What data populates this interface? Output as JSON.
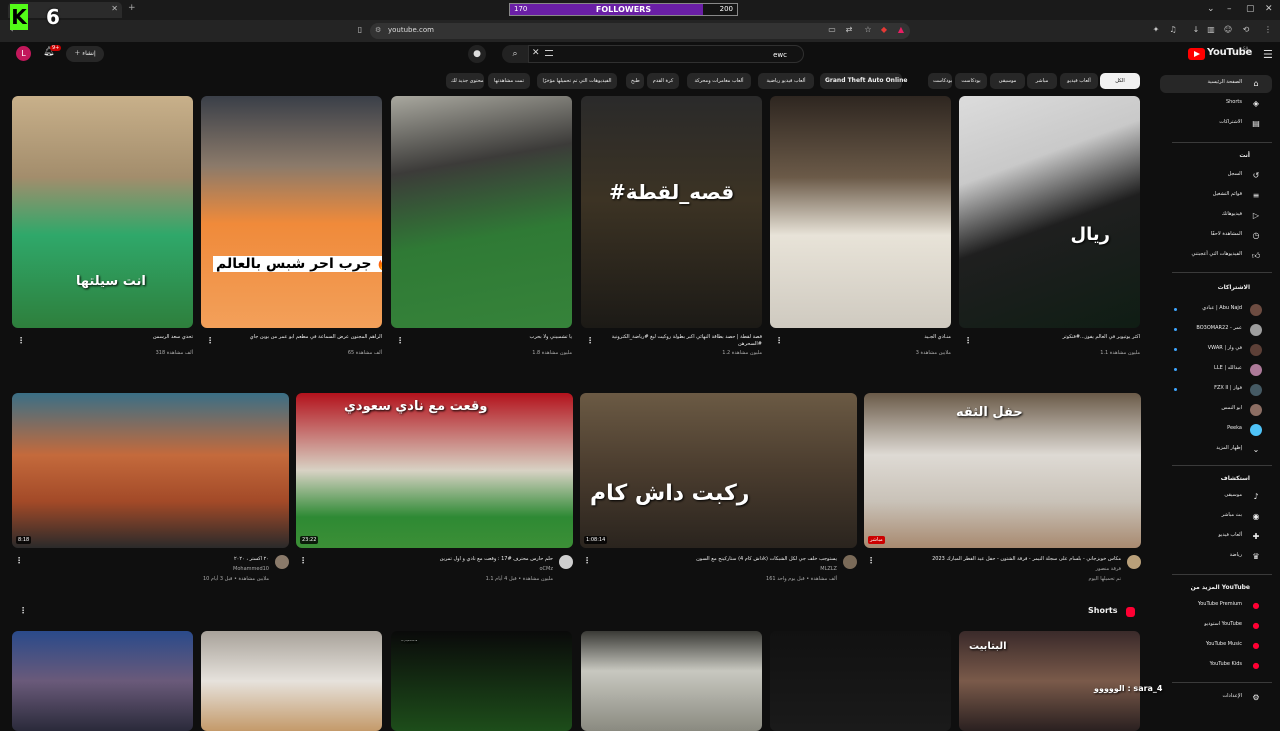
{
  "browser": {
    "tab_title": "",
    "url": "youtube.com"
  },
  "overlay": {
    "kick_logo": "K",
    "kick_number": "6",
    "followers_label": "FOLLOWERS",
    "followers_current": "170",
    "followers_goal": "200",
    "followers_fraction": 0.85,
    "chat_line": "الووووو : sara_4"
  },
  "header": {
    "logo_text": "YouTube",
    "logo_region": "SA",
    "search_value": "ewc",
    "create_label": "إنشاء",
    "notification_count": "9+",
    "avatar_letter": "L"
  },
  "chips": [
    {
      "label": "الكل"
    },
    {
      "label": "ألعاب فيديو"
    },
    {
      "label": "مباشر"
    },
    {
      "label": "موسيقى"
    },
    {
      "label": "بودكاست"
    },
    {
      "label": "بودكاست"
    },
    {
      "label": "Grand Theft Auto Online"
    },
    {
      "label": "ألعاب فيديو رياضية"
    },
    {
      "label": "ألعاب مغامرات ومحركة"
    },
    {
      "label": "كرة القدم"
    },
    {
      "label": "طبخ"
    },
    {
      "label": "الفيديوهات التي تم تحميلها مؤخرًا"
    },
    {
      "label": "تمت مشاهدتها"
    },
    {
      "label": "محتوى جديد لك"
    }
  ],
  "sidebar": {
    "main": [
      {
        "label": "الصفحة الرئيسية",
        "icon": "home-icon"
      },
      {
        "label": "Shorts",
        "icon": "shorts-icon"
      },
      {
        "label": "الاشتراكات",
        "icon": "subscriptions-icon"
      }
    ],
    "you_heading": "أنت",
    "you": [
      {
        "label": "السجل",
        "icon": "history-icon"
      },
      {
        "label": "قوائم التشغيل",
        "icon": "playlist-icon"
      },
      {
        "label": "فيديوهاتك",
        "icon": "your-videos-icon"
      },
      {
        "label": "المشاهدة لاحقًا",
        "icon": "watch-later-icon"
      },
      {
        "label": "الفيديوهات التي أعجبتني",
        "icon": "like-icon"
      }
    ],
    "subs_heading": "الاشتراكات",
    "subs": [
      {
        "label": "عبادي | Abu Najd"
      },
      {
        "label": "BO3OMAR22 - عمر"
      },
      {
        "label": "VWAR | في وار"
      },
      {
        "label": "LLE | عبدالله"
      },
      {
        "label": "FZX II | فواز"
      },
      {
        "label": "ابو النمس"
      },
      {
        "label": "Peeka"
      }
    ],
    "show_more": "إظهار المزيد",
    "explore_heading": "استكشاف",
    "explore": [
      {
        "label": "موسيقى",
        "icon": "music-icon"
      },
      {
        "label": "بث مباشر",
        "icon": "live-icon"
      },
      {
        "label": "ألعاب فيديو",
        "icon": "gaming-icon"
      },
      {
        "label": "رياضة",
        "icon": "trophy-icon"
      }
    ],
    "more_heading": "المزيد من YouTube",
    "more": [
      {
        "label": "YouTube Premium"
      },
      {
        "label": "استوديو YouTube"
      },
      {
        "label": "YouTube Music"
      },
      {
        "label": "YouTube Kids"
      }
    ],
    "settings": "الإعدادات"
  },
  "row1": [
    {
      "thumb_text": "ريال",
      "title": "أكثر يوتيوبر في العالم يفوز...#فتكوتر",
      "meta": "1.1 مليون مشاهدة"
    },
    {
      "thumb_text": "",
      "title": "منـادي الجـيد",
      "meta": "3 ملايين مشاهدة"
    },
    {
      "thumb_text": "#قصه_لقطة",
      "title": "قصة لقطة | حصد بطاقة النهائي اكبر بطولة روكيت ليغ #رياضة_الكترونية #السحرهن",
      "meta": "1.2 مليون مشاهدة"
    },
    {
      "thumb_text": "",
      "title": "يا تشمبيني ولا بحرب",
      "meta": "1.8 مليون مشاهدة"
    },
    {
      "thumb_text": "جرب احر شبس بالعالم 🔥",
      "title": "الراهم المجنون عرض السماعة في مطعم ابو عمر من بوين جاي",
      "meta": "65 ألف مشاهدة"
    },
    {
      "thumb_text": "انت سيلتها",
      "title": "تحدي سعد الرسمن",
      "meta": "318 ألف مشاهدة"
    }
  ],
  "row2": [
    {
      "thumb_text": "حفل الثقه",
      "duration": "مباشر",
      "title": "مكاس خويزجاني - بلسام على سجلة النيمر - فرقة الشتون - حفل عيد الفطر المبارك 2023",
      "channel": "فرقة منصور",
      "meta": "تم تحميلها اليوم"
    },
    {
      "thumb_text": "ركبت داش كام",
      "duration": "1:08:14",
      "title": "ستاركينج مع السون (داش كام 4k) يستوجب خلف جي لكل الشبكات",
      "channel": "MLZLZ",
      "meta": "161 ألف مشاهدة • قبل يوم واحد"
    },
    {
      "thumb_text": "وقعت مع نادي سعودي",
      "duration": "23:22",
      "title": "حلم حارس محترف #17 : وقعت مع نادي و أول تمرين",
      "channel": "oCMz",
      "meta": "1.1 مليون مشاهدة • قبل 4 أيام"
    },
    {
      "thumb_text": "",
      "duration": "8:18",
      "title": "٢٠ اكستر ، ٢٠٢٠",
      "channel": "Mohammed10",
      "meta": "10 ملايين مشاهدة • قبل 3 أيام"
    }
  ],
  "shorts": {
    "heading": "Shorts",
    "items": [
      {
        "thumb_text": "البتابيت"
      },
      {
        "thumb_text": ""
      },
      {
        "thumb_text": ""
      },
      {
        "thumb_text": "POV: الاحت اذا مسكت الوكيتسن"
      },
      {
        "thumb_text": ""
      },
      {
        "thumb_text": ""
      }
    ]
  }
}
